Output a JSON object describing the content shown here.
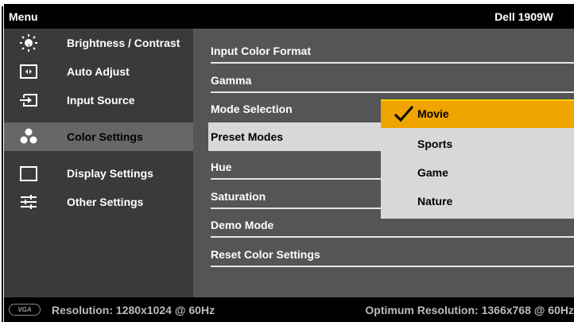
{
  "header": {
    "menu_title": "Menu",
    "model": "Dell 1909W"
  },
  "sidebar": {
    "items": [
      {
        "label": "Brightness / Contrast",
        "icon": "brightness-icon"
      },
      {
        "label": "Auto Adjust",
        "icon": "auto-adjust-icon"
      },
      {
        "label": "Input Source",
        "icon": "input-source-icon"
      },
      {
        "label": "Color Settings",
        "icon": "color-settings-icon",
        "active": true
      },
      {
        "label": "Display Settings",
        "icon": "display-settings-icon"
      },
      {
        "label": "Other Settings",
        "icon": "other-settings-icon"
      }
    ]
  },
  "panel": {
    "rows": [
      {
        "label": "Input Color Format"
      },
      {
        "label": "Gamma"
      },
      {
        "label": "Mode Selection"
      },
      {
        "label": "Preset Modes",
        "selected": true
      },
      {
        "label": "Hue"
      },
      {
        "label": "Saturation"
      },
      {
        "label": "Demo Mode"
      },
      {
        "label": "Reset Color Settings"
      }
    ]
  },
  "submenu": {
    "options": [
      {
        "label": "Movie",
        "checked": true
      },
      {
        "label": "Sports"
      },
      {
        "label": "Game"
      },
      {
        "label": "Nature"
      }
    ]
  },
  "footer": {
    "connector": "VGA",
    "resolution": "Resolution: 1280x1024 @ 60Hz",
    "optimum": "Optimum Resolution: 1366x768 @ 60Hz"
  },
  "colors": {
    "selection_bar": "#f0a400",
    "submenu_bg": "#d8d8d8",
    "sidebar_active": "#676767",
    "panel_bg": "#555555"
  }
}
